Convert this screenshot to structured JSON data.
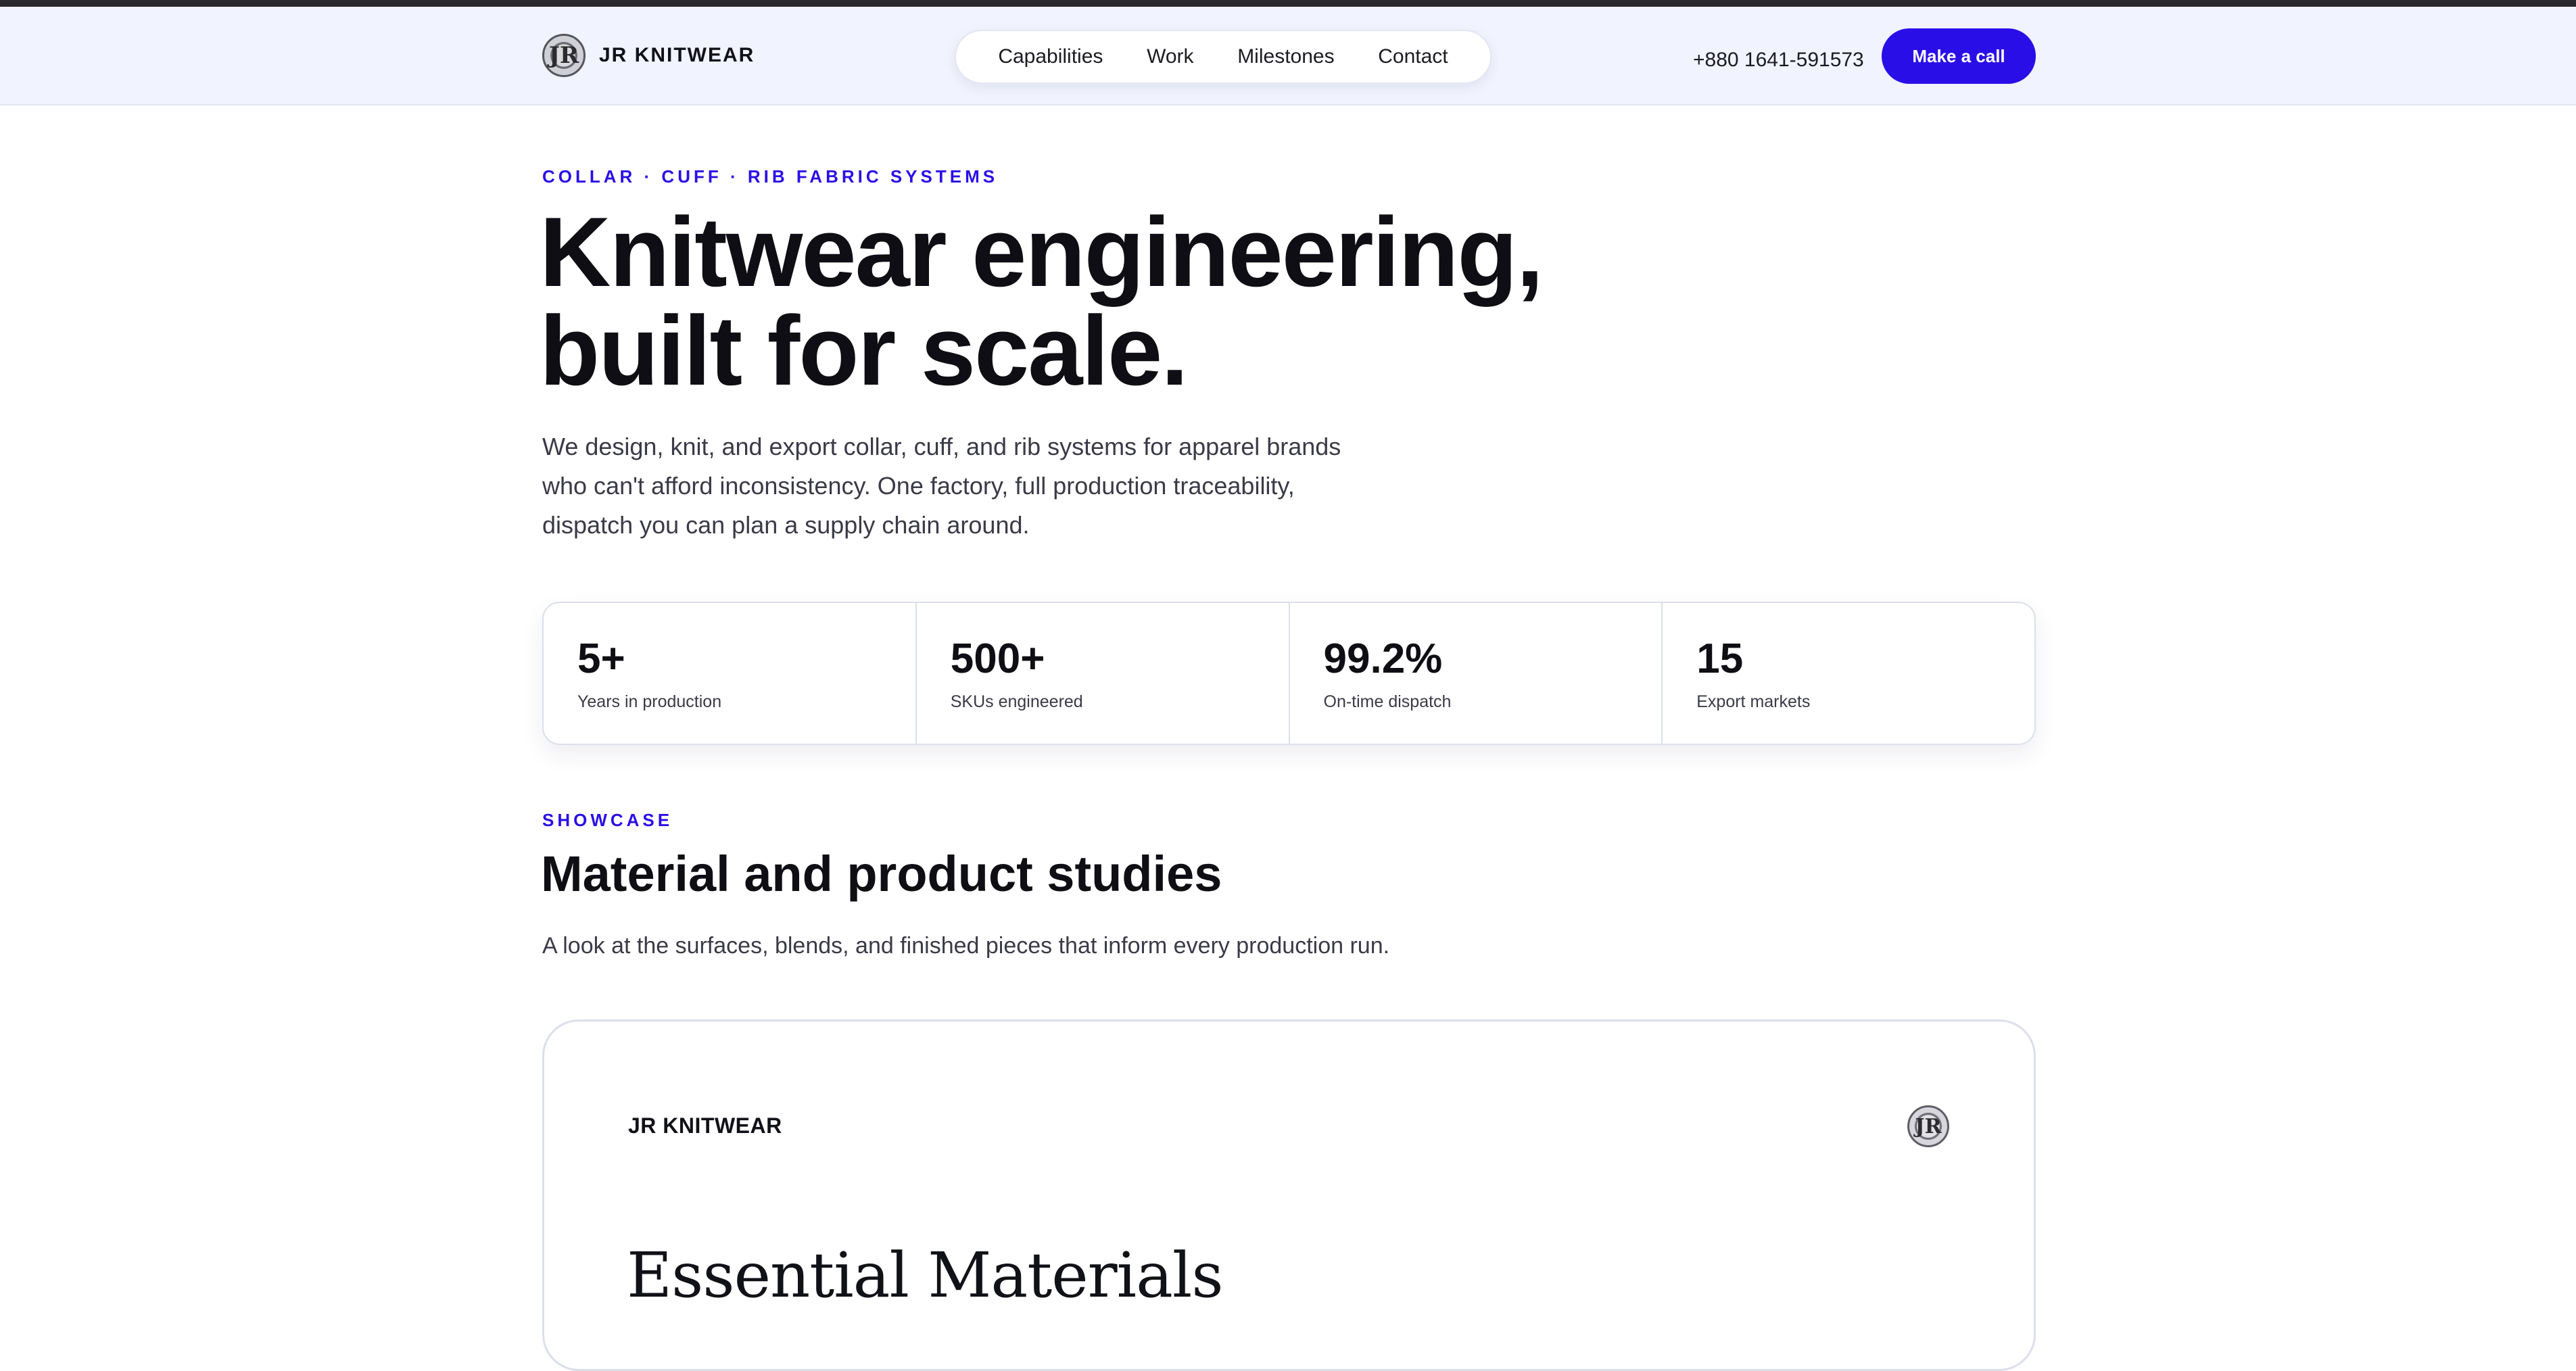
{
  "header": {
    "brand_name": "JR KNITWEAR",
    "brand_logo_text": "JR",
    "nav": [
      "Capabilities",
      "Work",
      "Milestones",
      "Contact"
    ],
    "phone": "+880 1641-591573",
    "cta_label": "Make a call"
  },
  "hero": {
    "eyebrow": "COLLAR · CUFF · RIB FABRIC SYSTEMS",
    "title_line1": "Knitwear engineering,",
    "title_line2": "built for scale.",
    "description_line1": "We design, knit, and export collar, cuff, and rib systems for apparel brands",
    "description_line2": "who can't afford inconsistency. One factory, full production traceability,",
    "description_line3": "dispatch you can plan a supply chain around."
  },
  "stats": [
    {
      "value": "5+",
      "label": "Years in production"
    },
    {
      "value": "500+",
      "label": "SKUs engineered"
    },
    {
      "value": "99.2%",
      "label": "On-time dispatch"
    },
    {
      "value": "15",
      "label": "Export markets"
    }
  ],
  "showcase": {
    "eyebrow": "SHOWCASE",
    "title": "Material and product studies",
    "description": "A look at the surfaces, blends, and finished pieces that inform every production run.",
    "card": {
      "brand": "JR KNITWEAR",
      "logo_text": "JR",
      "title": "Essential Materials"
    }
  },
  "colors": {
    "accent": "#2a0ee8",
    "header_bg": "#f1f3fe",
    "text": "#0e0e14"
  }
}
